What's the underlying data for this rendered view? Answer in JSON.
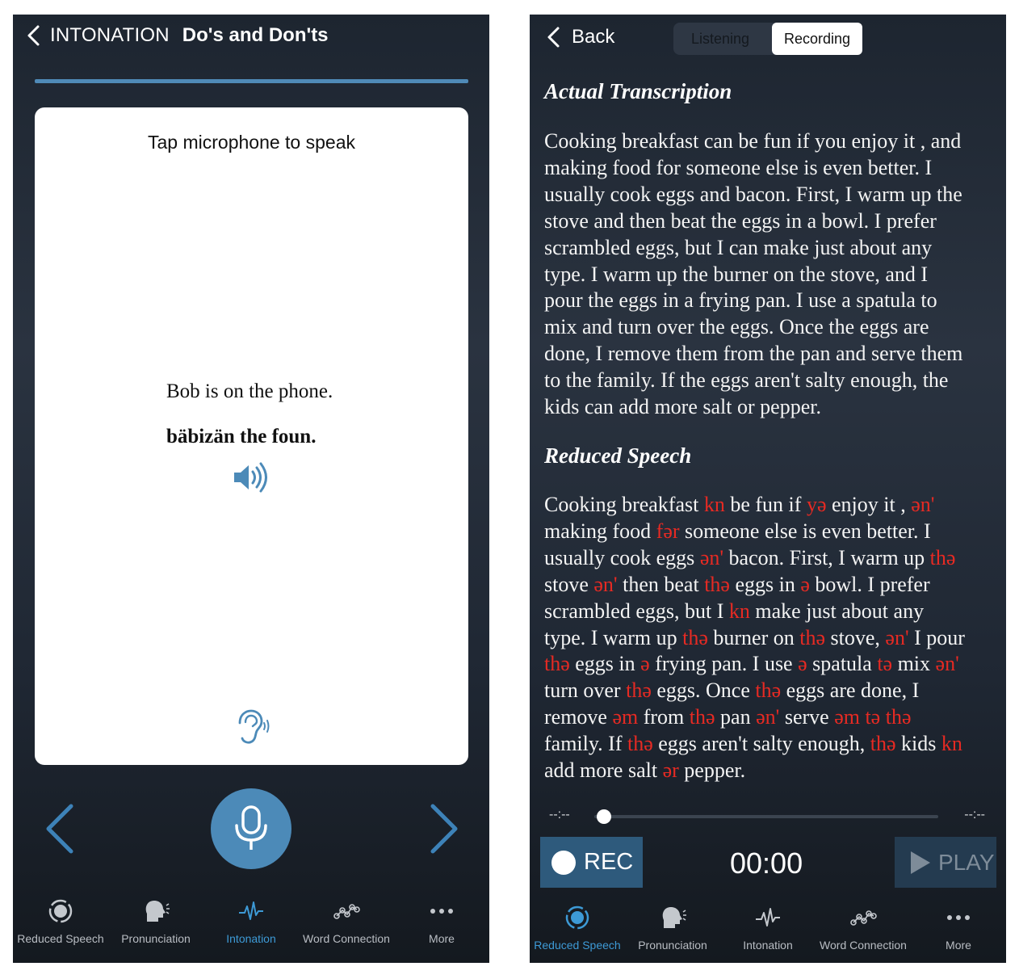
{
  "left": {
    "nav": {
      "section": "INTONATION",
      "title": "Do's and Don'ts"
    },
    "card": {
      "prompt": "Tap microphone to speak",
      "sentence": "Bob is on the phone.",
      "reduced": "bäbizän the foun."
    },
    "progress": 1.0
  },
  "right": {
    "back_label": "Back",
    "segments": [
      "Listening",
      "Recording"
    ],
    "active_segment": "Recording",
    "actual_heading": "Actual Transcription",
    "actual_lines": [
      "Cooking breakfast can be fun if you enjoy it , and",
      "making food for someone else is even better. I",
      "usually cook eggs and bacon. First, I warm up the",
      "stove and then beat the eggs in a bowl. I prefer",
      "scrambled eggs, but I can make just about any",
      "type. I warm up the burner on the stove, and I",
      "pour the eggs in a frying pan. I use a spatula to",
      "mix and turn over the eggs. Once the eggs are",
      "done, I remove them from the pan and serve them",
      "to the family. If the eggs aren't salty enough, the",
      "kids can add more salt or pepper."
    ],
    "reduced_heading": "Reduced Speech",
    "reduced_lines": [
      [
        {
          "t": "Cooking breakfast "
        },
        {
          "t": "kn",
          "r": true
        },
        {
          "t": " be fun if "
        },
        {
          "t": "yə",
          "r": true
        },
        {
          "t": " enjoy it , "
        },
        {
          "t": "ən'",
          "r": true
        }
      ],
      [
        {
          "t": "making food "
        },
        {
          "t": "fər",
          "r": true
        },
        {
          "t": " someone else is even better. I"
        }
      ],
      [
        {
          "t": "usually cook eggs "
        },
        {
          "t": "ən'",
          "r": true
        },
        {
          "t": " bacon. First, I warm up "
        },
        {
          "t": "thə",
          "r": true
        }
      ],
      [
        {
          "t": "stove "
        },
        {
          "t": "ən'",
          "r": true
        },
        {
          "t": " then beat "
        },
        {
          "t": "thə",
          "r": true
        },
        {
          "t": " eggs in "
        },
        {
          "t": "ə",
          "r": true
        },
        {
          "t": " bowl. I prefer"
        }
      ],
      [
        {
          "t": "scrambled eggs, but I "
        },
        {
          "t": "kn",
          "r": true
        },
        {
          "t": " make just about any"
        }
      ],
      [
        {
          "t": "type. I warm up "
        },
        {
          "t": "thə",
          "r": true
        },
        {
          "t": " burner on "
        },
        {
          "t": "thə",
          "r": true
        },
        {
          "t": " stove, "
        },
        {
          "t": "ən'",
          "r": true
        },
        {
          "t": " I pour"
        }
      ],
      [
        {
          "t": "thə",
          "r": true
        },
        {
          "t": " eggs in "
        },
        {
          "t": "ə",
          "r": true
        },
        {
          "t": " frying pan. I use "
        },
        {
          "t": "ə",
          "r": true
        },
        {
          "t": " spatula "
        },
        {
          "t": "tə",
          "r": true
        },
        {
          "t": " mix "
        },
        {
          "t": "ən'",
          "r": true
        }
      ],
      [
        {
          "t": "turn over "
        },
        {
          "t": "thə",
          "r": true
        },
        {
          "t": " eggs. Once "
        },
        {
          "t": "thə",
          "r": true
        },
        {
          "t": " eggs are done, I"
        }
      ],
      [
        {
          "t": "remove "
        },
        {
          "t": "əm",
          "r": true
        },
        {
          "t": " from "
        },
        {
          "t": "thə",
          "r": true
        },
        {
          "t": " pan "
        },
        {
          "t": "ən'",
          "r": true
        },
        {
          "t": " serve "
        },
        {
          "t": "əm tə thə",
          "r": true
        }
      ],
      [
        {
          "t": "family. If "
        },
        {
          "t": "thə",
          "r": true
        },
        {
          "t": " eggs aren't salty enough, "
        },
        {
          "t": "thə",
          "r": true
        },
        {
          "t": " kids "
        },
        {
          "t": "kn",
          "r": true
        }
      ],
      [
        {
          "t": "add more salt "
        },
        {
          "t": "ər",
          "r": true
        },
        {
          "t": " pepper."
        }
      ]
    ],
    "player": {
      "elapsed": "--:--",
      "remaining": "--:--",
      "position": 0.0,
      "rec_label": "REC",
      "clock": "00:00",
      "play_label": "PLAY"
    }
  },
  "tabs": [
    "Reduced Speech",
    "Pronunciation",
    "Intonation",
    "Word Connection",
    "More"
  ],
  "left_active_tab": "Intonation",
  "right_active_tab": "Reduced Speech",
  "colors": {
    "accent": "#3d9ad6",
    "mic": "#4c8ab8",
    "highlight": "#e62a23",
    "rec_button": "#2e5a7c"
  }
}
